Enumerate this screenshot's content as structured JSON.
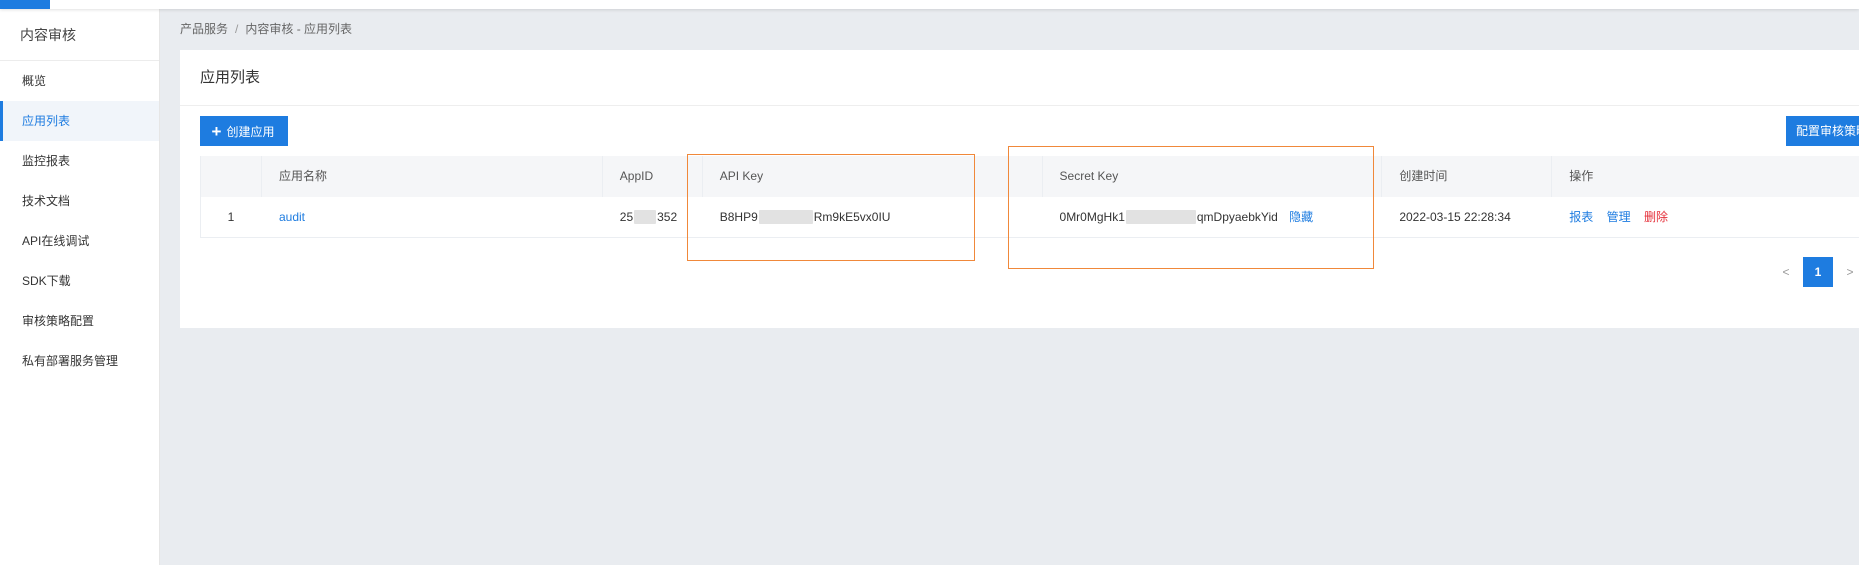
{
  "sidebar": {
    "title": "内容审核",
    "items": [
      {
        "label": "概览",
        "active": false
      },
      {
        "label": "应用列表",
        "active": true
      },
      {
        "label": "监控报表",
        "active": false
      },
      {
        "label": "技术文档",
        "active": false
      },
      {
        "label": "API在线调试",
        "active": false
      },
      {
        "label": "SDK下载",
        "active": false
      },
      {
        "label": "审核策略配置",
        "active": false
      },
      {
        "label": "私有部署服务管理",
        "active": false
      }
    ]
  },
  "breadcrumb": {
    "root": "产品服务",
    "separator": "/",
    "current": "内容审核 - 应用列表"
  },
  "panel": {
    "title": "应用列表",
    "create_button": "创建应用",
    "config_button": "配置审核策略"
  },
  "table": {
    "headers": {
      "name": "应用名称",
      "appid": "AppID",
      "api_key": "API Key",
      "secret_key": "Secret Key",
      "created": "创建时间",
      "ops": "操作"
    },
    "rows": [
      {
        "index": "1",
        "name": "audit",
        "appid_start": "25",
        "appid_end": "352",
        "api_key_start": "B8HP9",
        "api_key_end": "Rm9kE5vx0IU",
        "secret_key_start": "0Mr0MgHk1",
        "secret_key_end": "qmDpyaebkYid",
        "hide_label": "隐藏",
        "created": "2022-03-15 22:28:34",
        "op_report": "报表",
        "op_manage": "管理",
        "op_delete": "删除"
      }
    ]
  },
  "pagination": {
    "prev": "<",
    "current": "1",
    "next": ">"
  },
  "colors": {
    "accent": "#1e7ce0",
    "danger": "#e5303a",
    "highlight": "#f0883a"
  }
}
